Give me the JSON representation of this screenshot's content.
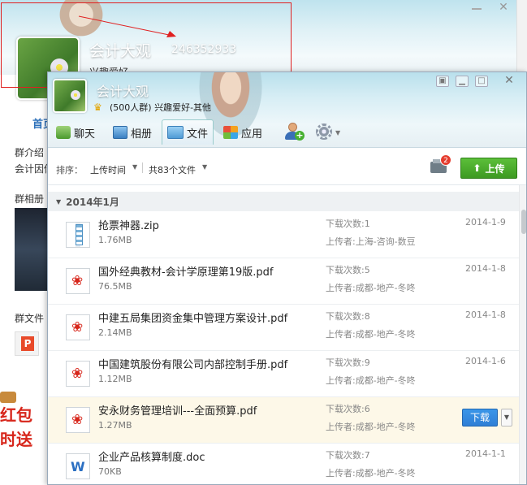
{
  "background_window": {
    "group_name": "会计大观",
    "group_number": "246352933",
    "interest_text": "兴趣爱好",
    "home_tab": "首页",
    "intro_title": "群介绍",
    "intro_text": "会计因你",
    "album_title": "群相册",
    "files_title": "群文件",
    "promo_line1": "红包",
    "promo_line2": "时送"
  },
  "group": {
    "name": "会计大观",
    "meta": "(500人群) 兴趣爱好-其他"
  },
  "tabs": [
    {
      "label": "聊天"
    },
    {
      "label": "相册"
    },
    {
      "label": "文件"
    },
    {
      "label": "应用"
    }
  ],
  "toolbar": {
    "sort_label": "排序：",
    "sort_value": "上传时间",
    "file_count": "共83个文件",
    "notify_count": "2",
    "upload_label": "上传"
  },
  "list": {
    "group_label": "2014年1月",
    "download_button": "下载",
    "rows": [
      {
        "name": "抢票神器.zip",
        "size": "1.76MB",
        "downloads": "下载次数:1",
        "uploader": "上传者:上海-咨询-数豆",
        "date": "2014-1-9",
        "type": "zip"
      },
      {
        "name": "国外经典教材-会计学原理第19版.pdf",
        "size": "76.5MB",
        "downloads": "下载次数:5",
        "uploader": "上传者:成都-地产-冬咚",
        "date": "2014-1-8",
        "type": "pdf"
      },
      {
        "name": "中建五局集团资金集中管理方案设计.pdf",
        "size": "2.14MB",
        "downloads": "下载次数:8",
        "uploader": "上传者:成都-地产-冬咚",
        "date": "2014-1-8",
        "type": "pdf"
      },
      {
        "name": "中国建筑股份有限公司内部控制手册.pdf",
        "size": "1.12MB",
        "downloads": "下载次数:9",
        "uploader": "上传者:成都-地产-冬咚",
        "date": "2014-1-6",
        "type": "pdf"
      },
      {
        "name": "安永财务管理培训---全面预算.pdf",
        "size": "1.27MB",
        "downloads": "下载次数:6",
        "uploader": "上传者:成都-地产-冬咚",
        "date": "",
        "type": "pdf"
      },
      {
        "name": "企业产品核算制度.doc",
        "size": "70KB",
        "downloads": "下载次数:7",
        "uploader": "上传者:成都-地产-冬咚",
        "date": "2014-1-1",
        "type": "doc"
      }
    ]
  }
}
